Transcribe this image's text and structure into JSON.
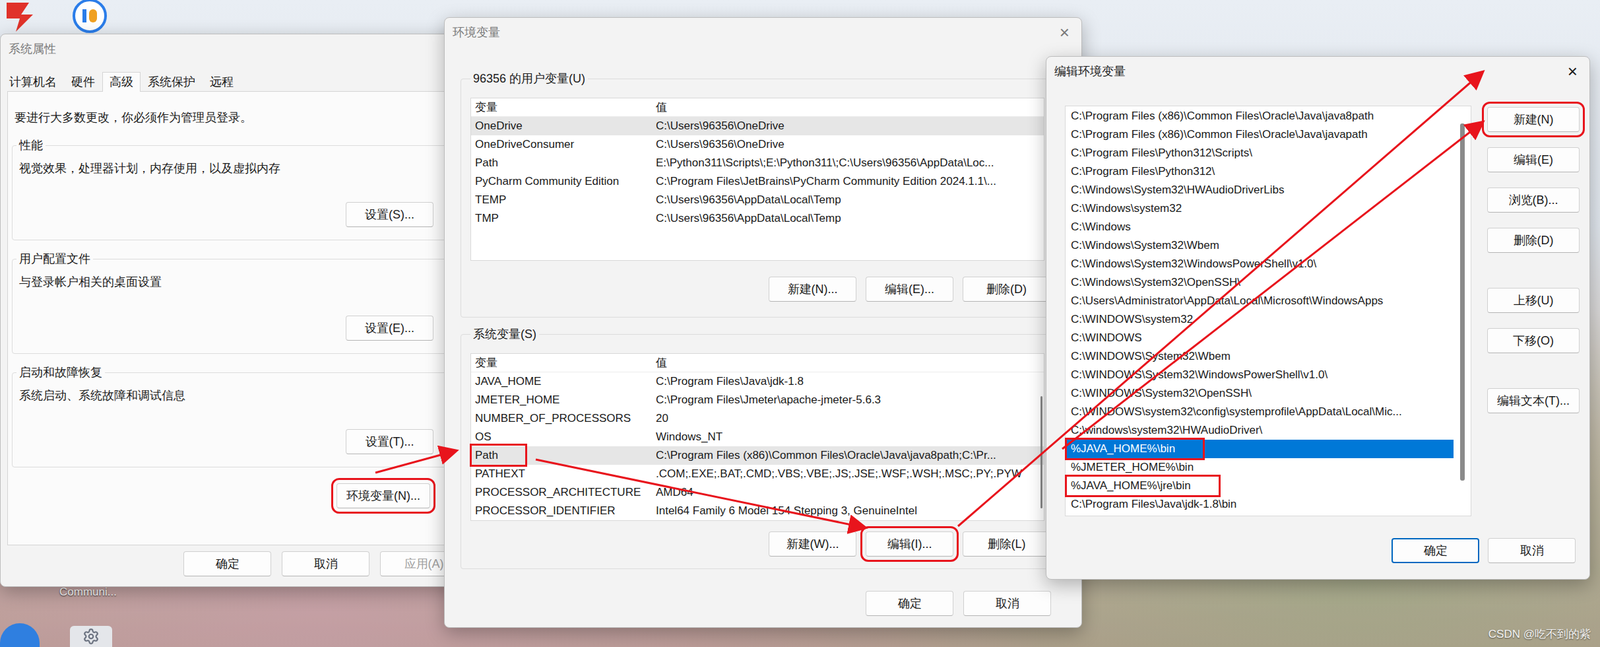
{
  "desktop": {
    "icon_label": "Communi...",
    "watermark": "CSDN @吃不到的紫"
  },
  "system_properties": {
    "title": "系统属性",
    "active": false,
    "tabs": [
      {
        "label": "计算机名",
        "selected": false
      },
      {
        "label": "硬件",
        "selected": false
      },
      {
        "label": "高级",
        "selected": true
      },
      {
        "label": "系统保护",
        "selected": false
      },
      {
        "label": "远程",
        "selected": false
      }
    ],
    "notice": "要进行大多数更改，你必须作为管理员登录。",
    "groups": [
      {
        "title": "性能",
        "description": "视觉效果，处理器计划，内存使用，以及虚拟内存",
        "button": "设置(S)..."
      },
      {
        "title": "用户配置文件",
        "description": "与登录帐户相关的桌面设置",
        "button": "设置(E)..."
      },
      {
        "title": "启动和故障恢复",
        "description": "系统启动、系统故障和调试信息",
        "button": "设置(T)..."
      }
    ],
    "env_button": {
      "label": "环境变量(N)...",
      "annotated": true
    },
    "buttons": [
      {
        "label": "确定",
        "disabled": false
      },
      {
        "label": "取消",
        "disabled": false
      },
      {
        "label": "应用(A)",
        "disabled": true
      }
    ]
  },
  "environment_variables": {
    "title": "环境变量",
    "close": "×",
    "active": false,
    "user_group": {
      "title": "96356 的用户变量(U)",
      "columns": [
        "变量",
        "值"
      ],
      "rows": [
        {
          "name": "OneDrive",
          "value": "C:\\Users\\96356\\OneDrive",
          "selected": true,
          "annotated": false
        },
        {
          "name": "OneDriveConsumer",
          "value": "C:\\Users\\96356\\OneDrive",
          "selected": false,
          "annotated": false
        },
        {
          "name": "Path",
          "value": "E:\\Python311\\Scripts\\;E:\\Python311\\;C:\\Users\\96356\\AppData\\Loc...",
          "selected": false,
          "annotated": false
        },
        {
          "name": "PyCharm Community Edition",
          "value": "C:\\Program Files\\JetBrains\\PyCharm Community Edition 2024.1.1\\...",
          "selected": false,
          "annotated": false
        },
        {
          "name": "TEMP",
          "value": "C:\\Users\\96356\\AppData\\Local\\Temp",
          "selected": false,
          "annotated": false
        },
        {
          "name": "TMP",
          "value": "C:\\Users\\96356\\AppData\\Local\\Temp",
          "selected": false,
          "annotated": false
        }
      ],
      "buttons": [
        {
          "label": "新建(N)...",
          "annotated": false
        },
        {
          "label": "编辑(E)...",
          "annotated": false
        },
        {
          "label": "删除(D)",
          "annotated": false
        }
      ]
    },
    "system_group": {
      "title": "系统变量(S)",
      "columns": [
        "变量",
        "值"
      ],
      "rows": [
        {
          "name": "JAVA_HOME",
          "value": "C:\\Program Files\\Java\\jdk-1.8",
          "selected": false,
          "annotated": false
        },
        {
          "name": "JMETER_HOME",
          "value": "C:\\Program Files\\Jmeter\\apache-jmeter-5.6.3",
          "selected": false,
          "annotated": false
        },
        {
          "name": "NUMBER_OF_PROCESSORS",
          "value": "20",
          "selected": false,
          "annotated": false
        },
        {
          "name": "OS",
          "value": "Windows_NT",
          "selected": false,
          "annotated": false
        },
        {
          "name": "Path",
          "value": "C:\\Program Files (x86)\\Common Files\\Oracle\\Java\\java8path;C:\\Pr...",
          "selected": true,
          "annotated": true
        },
        {
          "name": "PATHEXT",
          "value": ".COM;.EXE;.BAT;.CMD;.VBS;.VBE;.JS;.JSE;.WSF;.WSH;.MSC;.PY;.PYW",
          "selected": false,
          "annotated": false
        },
        {
          "name": "PROCESSOR_ARCHITECTURE",
          "value": "AMD64",
          "selected": false,
          "annotated": false
        },
        {
          "name": "PROCESSOR_IDENTIFIER",
          "value": "Intel64 Family 6 Model 154 Stepping 3, GenuineIntel",
          "selected": false,
          "annotated": false
        }
      ],
      "buttons": [
        {
          "label": "新建(W)...",
          "annotated": false
        },
        {
          "label": "编辑(I)...",
          "annotated": true
        },
        {
          "label": "删除(L)",
          "annotated": false
        }
      ]
    },
    "buttons": [
      {
        "label": "确定"
      },
      {
        "label": "取消"
      }
    ]
  },
  "edit_variable": {
    "title": "编辑环境变量",
    "close": "×",
    "active": true,
    "items": [
      {
        "text": "C:\\Program Files (x86)\\Common Files\\Oracle\\Java\\java8path",
        "selected": false,
        "annotated": false
      },
      {
        "text": "C:\\Program Files (x86)\\Common Files\\Oracle\\Java\\javapath",
        "selected": false,
        "annotated": false
      },
      {
        "text": "C:\\Program Files\\Python312\\Scripts\\",
        "selected": false,
        "annotated": false
      },
      {
        "text": "C:\\Program Files\\Python312\\",
        "selected": false,
        "annotated": false
      },
      {
        "text": "C:\\Windows\\System32\\HWAudioDriverLibs",
        "selected": false,
        "annotated": false
      },
      {
        "text": "C:\\Windows\\system32",
        "selected": false,
        "annotated": false
      },
      {
        "text": "C:\\Windows",
        "selected": false,
        "annotated": false
      },
      {
        "text": "C:\\Windows\\System32\\Wbem",
        "selected": false,
        "annotated": false
      },
      {
        "text": "C:\\Windows\\System32\\WindowsPowerShell\\v1.0\\",
        "selected": false,
        "annotated": false
      },
      {
        "text": "C:\\Windows\\System32\\OpenSSH\\",
        "selected": false,
        "annotated": false
      },
      {
        "text": "C:\\Users\\Administrator\\AppData\\Local\\Microsoft\\WindowsApps",
        "selected": false,
        "annotated": false
      },
      {
        "text": "C:\\WINDOWS\\system32",
        "selected": false,
        "annotated": false
      },
      {
        "text": "C:\\WINDOWS",
        "selected": false,
        "annotated": false
      },
      {
        "text": "C:\\WINDOWS\\System32\\Wbem",
        "selected": false,
        "annotated": false
      },
      {
        "text": "C:\\WINDOWS\\System32\\WindowsPowerShell\\v1.0\\",
        "selected": false,
        "annotated": false
      },
      {
        "text": "C:\\WINDOWS\\System32\\OpenSSH\\",
        "selected": false,
        "annotated": false
      },
      {
        "text": "C:\\WINDOWS\\system32\\config\\systemprofile\\AppData\\Local\\Mic...",
        "selected": false,
        "annotated": false
      },
      {
        "text": "C:\\windows\\system32\\HWAudioDriver\\",
        "selected": false,
        "annotated": false
      },
      {
        "text": "%JAVA_HOME%\\bin",
        "selected": true,
        "annotated": true
      },
      {
        "text": "%JMETER_HOME%\\bin",
        "selected": false,
        "annotated": false
      },
      {
        "text": "%JAVA_HOME%\\jre\\bin",
        "selected": false,
        "annotated": true
      },
      {
        "text": "C:\\Program Files\\Java\\jdk-1.8\\bin",
        "selected": false,
        "annotated": false
      }
    ],
    "button_groups": [
      [
        {
          "label": "新建(N)",
          "annotated": true
        },
        {
          "label": "编辑(E)",
          "annotated": false
        },
        {
          "label": "浏览(B)...",
          "annotated": false
        },
        {
          "label": "删除(D)",
          "annotated": false
        }
      ],
      [
        {
          "label": "上移(U)",
          "annotated": false
        },
        {
          "label": "下移(O)",
          "annotated": false
        }
      ],
      [
        {
          "label": "编辑文本(T)...",
          "annotated": false
        }
      ]
    ],
    "buttons": [
      {
        "label": "确定",
        "default": true
      },
      {
        "label": "取消",
        "default": false
      }
    ]
  }
}
